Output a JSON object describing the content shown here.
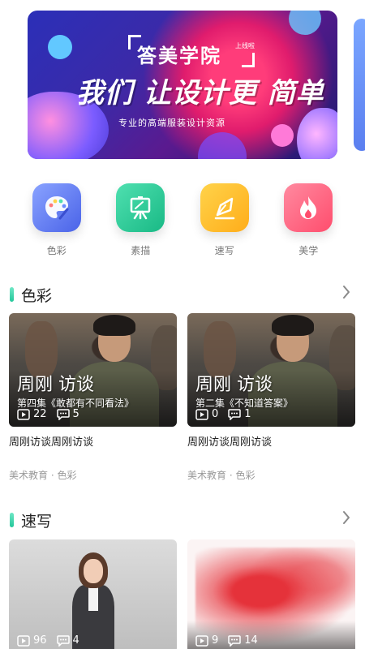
{
  "banner": {
    "title_top": "答美学院",
    "tag": "上线啦",
    "title_main": "我们 让设计更 简单",
    "subtitle": "专业的高端服装设计资源"
  },
  "categories": [
    {
      "label": "色彩",
      "icon": "palette-icon"
    },
    {
      "label": "素描",
      "icon": "easel-icon"
    },
    {
      "label": "速写",
      "icon": "pen-nib-icon"
    },
    {
      "label": "美学",
      "icon": "flame-icon"
    }
  ],
  "sections": [
    {
      "title": "色彩",
      "more_icon": "chevron-right-icon",
      "cards": [
        {
          "overlay_big": "周刚 访谈",
          "overlay_small": "第四集《敢都有不同看法》",
          "plays": "22",
          "comments": "5",
          "title": "周刚访谈周刚访谈",
          "meta": "美术教育 · 色彩"
        },
        {
          "overlay_big": "周刚 访谈",
          "overlay_small": "第二集《不知道答案》",
          "plays": "0",
          "comments": "1",
          "title": "周刚访谈周刚访谈",
          "meta": "美术教育 · 色彩"
        }
      ]
    },
    {
      "title": "速写",
      "more_icon": "chevron-right-icon",
      "cards": [
        {
          "plays": "96",
          "comments": "4"
        },
        {
          "plays": "9",
          "comments": "14"
        }
      ]
    }
  ],
  "colors": {
    "accent": "#23c79a",
    "color_icon": "#4a63e8",
    "sketch_icon": "#19b985",
    "quick_icon": "#ffad1a",
    "beauty_icon": "#ff4d6d"
  }
}
